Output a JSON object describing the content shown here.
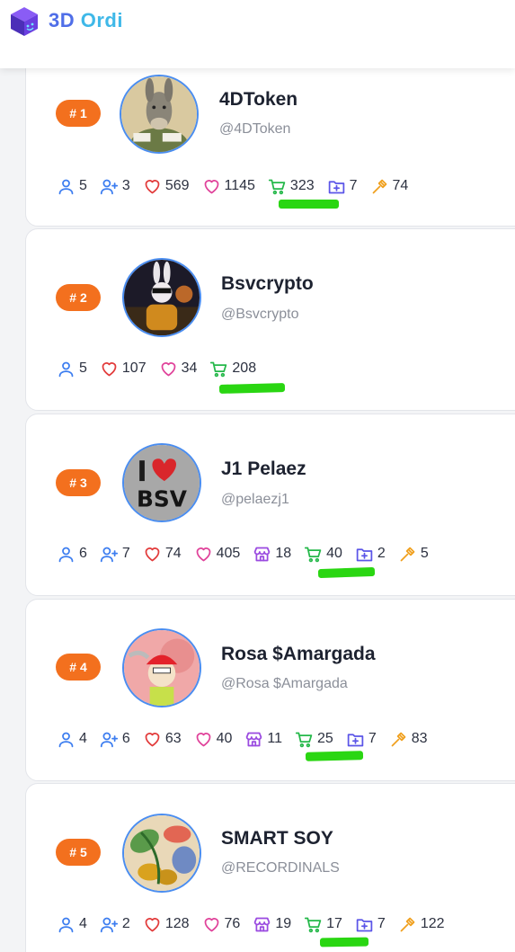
{
  "app": {
    "title_part1": "3D",
    "title_part2": "Ordi"
  },
  "colors": {
    "rank_badge": "#f3701e",
    "cart_highlight": "#2ad612",
    "avatar_border": "#4a8df0"
  },
  "leaderboard": [
    {
      "rank": "# 1",
      "name": "4DToken",
      "handle": "@4DToken",
      "stats": [
        {
          "icon": "user-icon",
          "value": "5"
        },
        {
          "icon": "user-plus-icon",
          "value": "3"
        },
        {
          "icon": "heart-red-icon",
          "value": "569"
        },
        {
          "icon": "heart-pink-icon",
          "value": "1145"
        },
        {
          "icon": "cart-icon",
          "value": "323"
        },
        {
          "icon": "folder-plus-icon",
          "value": "7"
        },
        {
          "icon": "hammer-icon",
          "value": "74"
        }
      ]
    },
    {
      "rank": "# 2",
      "name": "Bsvcrypto",
      "handle": "@Bsvcrypto",
      "stats": [
        {
          "icon": "user-icon",
          "value": "5"
        },
        {
          "icon": "heart-red-icon",
          "value": "107"
        },
        {
          "icon": "heart-pink-icon",
          "value": "34"
        },
        {
          "icon": "cart-icon",
          "value": "208"
        }
      ]
    },
    {
      "rank": "# 3",
      "name": "J1 Pelaez",
      "handle": "@pelaezj1",
      "stats": [
        {
          "icon": "user-icon",
          "value": "6"
        },
        {
          "icon": "user-plus-icon",
          "value": "7"
        },
        {
          "icon": "heart-red-icon",
          "value": "74"
        },
        {
          "icon": "heart-pink-icon",
          "value": "405"
        },
        {
          "icon": "store-icon",
          "value": "18"
        },
        {
          "icon": "cart-icon",
          "value": "40"
        },
        {
          "icon": "folder-plus-icon",
          "value": "2"
        },
        {
          "icon": "hammer-icon",
          "value": "5"
        }
      ]
    },
    {
      "rank": "# 4",
      "name": "Rosa $Amargada",
      "handle": "@Rosa $Amargada",
      "stats": [
        {
          "icon": "user-icon",
          "value": "4"
        },
        {
          "icon": "user-plus-icon",
          "value": "6"
        },
        {
          "icon": "heart-red-icon",
          "value": "63"
        },
        {
          "icon": "heart-pink-icon",
          "value": "40"
        },
        {
          "icon": "store-icon",
          "value": "11"
        },
        {
          "icon": "cart-icon",
          "value": "25"
        },
        {
          "icon": "folder-plus-icon",
          "value": "7"
        },
        {
          "icon": "hammer-icon",
          "value": "83"
        }
      ]
    },
    {
      "rank": "# 5",
      "name": "SMART SOY",
      "handle": "@RECORDINALS",
      "stats": [
        {
          "icon": "user-icon",
          "value": "4"
        },
        {
          "icon": "user-plus-icon",
          "value": "2"
        },
        {
          "icon": "heart-red-icon",
          "value": "128"
        },
        {
          "icon": "heart-pink-icon",
          "value": "76"
        },
        {
          "icon": "store-icon",
          "value": "19"
        },
        {
          "icon": "cart-icon",
          "value": "17"
        },
        {
          "icon": "folder-plus-icon",
          "value": "7"
        },
        {
          "icon": "hammer-icon",
          "value": "122"
        }
      ]
    }
  ]
}
